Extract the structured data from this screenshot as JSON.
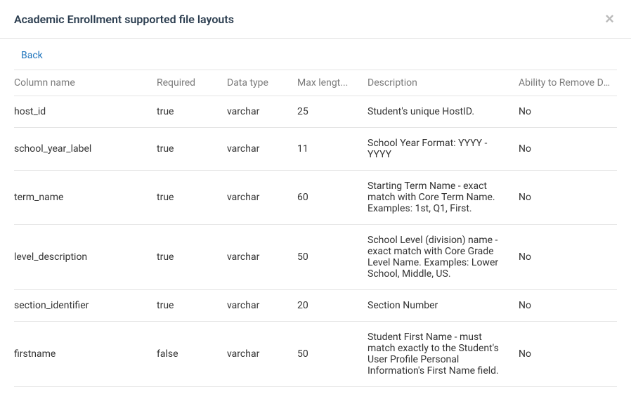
{
  "header": {
    "title": "Academic Enrollment supported file layouts"
  },
  "nav": {
    "back_label": "Back"
  },
  "table": {
    "headers": {
      "column_name": "Column name",
      "required": "Required",
      "data_type": "Data type",
      "max_length": "Max lengt...",
      "description": "Description",
      "ability_remove": "Ability to Remove Dat..."
    },
    "rows": [
      {
        "column_name": "host_id",
        "required": "true",
        "data_type": "varchar",
        "max_length": "25",
        "description": "Student's unique HostID.",
        "ability_remove": "No"
      },
      {
        "column_name": "school_year_label",
        "required": "true",
        "data_type": "varchar",
        "max_length": "11",
        "description": "School Year Format: YYYY - YYYY",
        "ability_remove": "No"
      },
      {
        "column_name": "term_name",
        "required": "true",
        "data_type": "varchar",
        "max_length": "60",
        "description": "Starting Term Name - exact match with Core Term Name. Examples: 1st, Q1, First.",
        "ability_remove": "No"
      },
      {
        "column_name": "level_description",
        "required": "true",
        "data_type": "varchar",
        "max_length": "50",
        "description": "School Level (division) name - exact match with Core Grade Level Name. Examples: Lower School, Middle, US.",
        "ability_remove": "No"
      },
      {
        "column_name": "section_identifier",
        "required": "true",
        "data_type": "varchar",
        "max_length": "20",
        "description": "Section Number",
        "ability_remove": "No"
      },
      {
        "column_name": "firstname",
        "required": "false",
        "data_type": "varchar",
        "max_length": "50",
        "description": "Student First Name - must match exactly to the Student's User Profile Personal Information's First Name field.",
        "ability_remove": "No"
      }
    ]
  }
}
